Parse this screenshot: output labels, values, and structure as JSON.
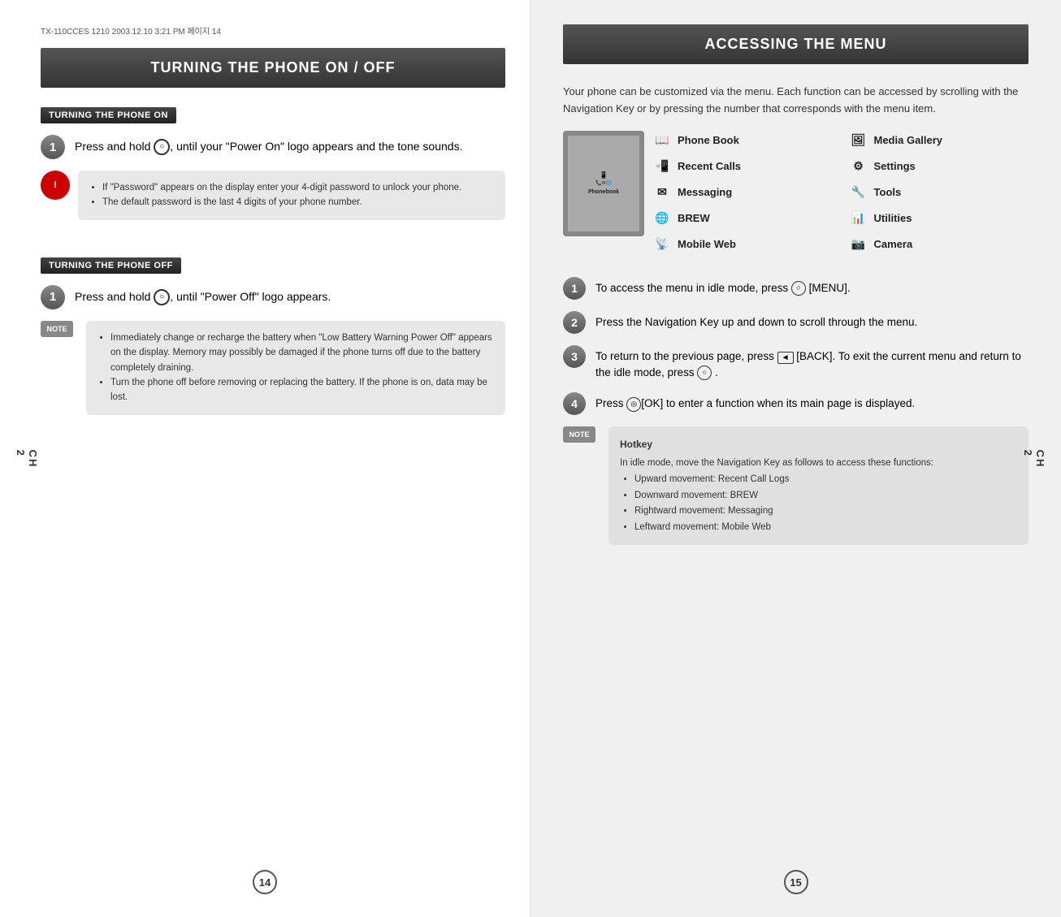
{
  "left": {
    "file_header": "TX-110CCES 1210  2003.12.10 3:21 PM  페이지 14",
    "title": "TURNING THE PHONE ON / OFF",
    "ch_label": "CH",
    "ch_number": "2",
    "page_number": "14",
    "turning_on": {
      "label": "TURNING THE PHONE ON",
      "step1_text": "Press and hold 🔘, until your \"Power On\" logo appears and the tone sounds.",
      "note_items": [
        "If \"Password\" appears on the display enter your 4-digit password to unlock your phone.",
        "The default password is the last 4 digits of your phone number."
      ]
    },
    "turning_off": {
      "label": "TURNING THE PHONE OFF",
      "step1_text": "Press and hold 🔘, until \"Power Off\" logo appears.",
      "note_items": [
        "Immediately change or recharge the battery when \"Low Battery Warning Power Off\" appears on the display. Memory may possibly be damaged if the phone turns off due to the battery completely draining.",
        "Turn the phone off before removing or replacing the battery. If the phone is on, data may be lost."
      ]
    }
  },
  "right": {
    "title": "ACCESSING THE MENU",
    "ch_label": "CH",
    "ch_number": "2",
    "page_number": "15",
    "intro": "Your phone can be customized via the menu. Each function can be accessed by scrolling with the Navigation Key or by pressing the number that corresponds with the menu item.",
    "menu_left_col": [
      {
        "icon": "📖",
        "label": "Phone Book"
      },
      {
        "icon": "📲",
        "label": "Recent Calls"
      },
      {
        "icon": "✉",
        "label": "Messaging"
      },
      {
        "icon": "🌐",
        "label": "BREW"
      },
      {
        "icon": "📱",
        "label": "Mobile Web"
      }
    ],
    "menu_right_col": [
      {
        "icon": "🖼",
        "label": "Media Gallery"
      },
      {
        "icon": "⚙",
        "label": "Settings"
      },
      {
        "icon": "🔧",
        "label": "Tools"
      },
      {
        "icon": "📊",
        "label": "Utilities"
      },
      {
        "icon": "📷",
        "label": "Camera"
      }
    ],
    "steps": [
      {
        "num": "1",
        "text": "To access the menu in idle mode, press 📱 [MENU]."
      },
      {
        "num": "2",
        "text": "Press the Navigation Key up and down to scroll through the menu."
      },
      {
        "num": "3",
        "text": "To return to the previous page, press ◄ [BACK]. To exit the current menu and return to the idle mode, press 🔘 ."
      },
      {
        "num": "4",
        "text": "Press ◎ [OK] to enter a function when its main page is displayed."
      }
    ],
    "hotkey": {
      "title": "Hotkey",
      "intro": "In idle mode, move the Navigation Key as follows to access these functions:",
      "items": [
        "Upward movement: Recent Call Logs",
        "Downward movement: BREW",
        "Rightward movement: Messaging",
        "Leftward movement: Mobile Web"
      ]
    }
  }
}
